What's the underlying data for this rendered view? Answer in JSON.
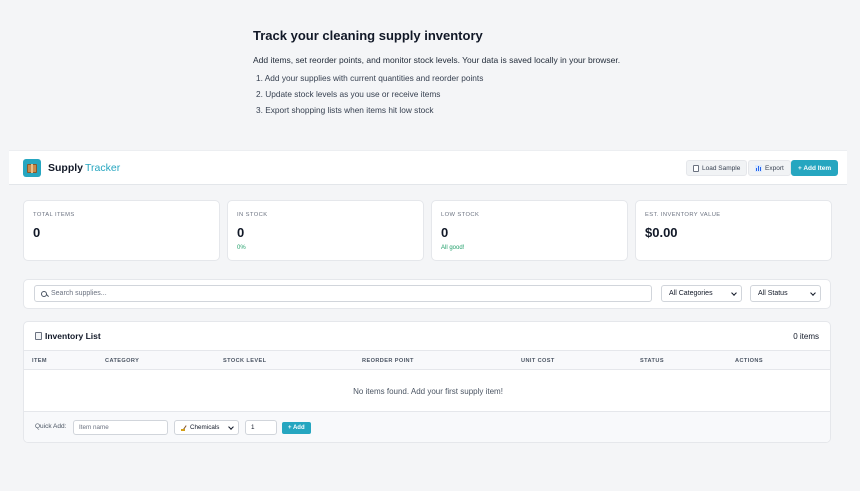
{
  "intro": {
    "title": "Track your cleaning supply inventory",
    "description": "Add items, set reorder points, and monitor stock levels. Your data is saved locally in your browser.",
    "steps": [
      "1. Add your supplies with current quantities and reorder points",
      "2. Update stock levels as you use or receive items",
      "3. Export shopping lists when items hit low stock"
    ]
  },
  "header": {
    "brand_primary": "Supply",
    "brand_accent": "Tracker",
    "logo_icon": "package-icon",
    "buttons": {
      "load_sample": "Load Sample",
      "export": "Export",
      "add_item": "+ Add Item"
    }
  },
  "stats": [
    {
      "label": "TOTAL ITEMS",
      "value": "0",
      "sub": ""
    },
    {
      "label": "IN STOCK",
      "value": "0",
      "sub": "0%"
    },
    {
      "label": "LOW STOCK",
      "value": "0",
      "sub": "All good!"
    },
    {
      "label": "EST. INVENTORY VALUE",
      "value": "$0.00",
      "sub": ""
    }
  ],
  "filters": {
    "search_placeholder": "Search supplies...",
    "category_selected": "All Categories",
    "status_selected": "All Status"
  },
  "inventory": {
    "title": "Inventory List",
    "count": "0 items",
    "columns": [
      "ITEM",
      "CATEGORY",
      "STOCK LEVEL",
      "REORDER POINT",
      "UNIT COST",
      "STATUS",
      "ACTIONS"
    ],
    "empty_message": "No items found. Add your first supply item!"
  },
  "quick_add": {
    "label": "Quick Add:",
    "name_placeholder": "Item name",
    "category_selected": "Chemicals",
    "quantity_value": "1",
    "add_button": "+ Add"
  },
  "colors": {
    "accent": "#26a6c0",
    "success": "#22a06b",
    "background": "#f4f5f7"
  }
}
